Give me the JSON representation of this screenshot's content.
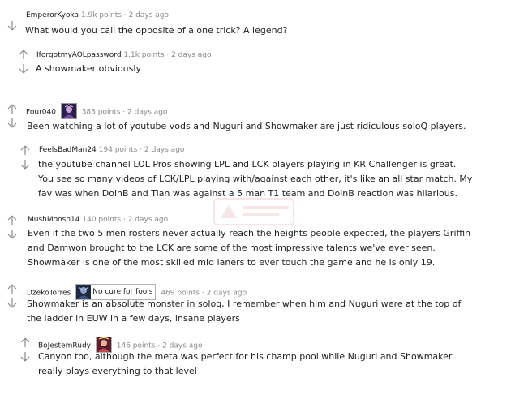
{
  "comments": [
    {
      "author": "EmperorKyoka",
      "points": "1.9k points",
      "separator": "·",
      "time": "2 days ago",
      "lines": [
        "What would you call the opposite of a one trick? A legend?"
      ]
    },
    {
      "author": "IforgotmyAOLpassword",
      "points": "1.1k points",
      "separator": "·",
      "time": "2 days ago",
      "lines": [
        "A showmaker obviously"
      ]
    },
    {
      "author": "Four040",
      "flair_icon": "champion-portrait-purple-icon",
      "points": "383 points",
      "separator": "·",
      "time": "2 days ago",
      "lines": [
        "Been watching a lot of youtube vods and Nuguri and Showmaker are just ridiculous soloQ players."
      ]
    },
    {
      "author": "FeelsBadMan24",
      "points": "194 points",
      "separator": "·",
      "time": "2 days ago",
      "lines": [
        "the youtube channel LOL Pros showing LPL and LCK players playing in KR Challenger is great.",
        "You see so many videos of LCK/LPL playing with/against each other, it's like an all star match. My",
        "fav was when DoinB and Tian was against a 5 man T1 team and DoinB reaction was hilarious."
      ]
    },
    {
      "author": "MushMoosh14",
      "points": "140 points",
      "separator": "·",
      "time": "2 days ago",
      "lines": [
        "Even if the two 5 men rosters never actually reach the heights people expected, the players Griffin",
        "and Damwon brought to the LCK are some of the most impressive talents we've ever seen.",
        "Showmaker is one of the most skilled mid laners to ever touch the game and he is only 19."
      ]
    },
    {
      "author": "DzekoTorres",
      "flair_icon": "champion-portrait-dark-icon",
      "flair_text": "No cure for fools",
      "points": "469 points",
      "separator": "·",
      "time": "2 days ago",
      "lines": [
        "Showmaker is an absolute monster in soloq, I remember when him and Nuguri were at the top of",
        "the ladder in EUW in a few days, insane players"
      ]
    },
    {
      "author": "BoJestemRudy",
      "flair_icon": "champion-portrait-red-icon",
      "points": "146 points",
      "separator": "·",
      "time": "2 days ago",
      "lines": [
        "Canyon too, although the meta was perfect for his champ pool while Nuguri and Showmaker",
        "really plays everything to that level"
      ]
    }
  ],
  "icons": {
    "upvote": "upvote-arrow-icon",
    "downvote": "downvote-arrow-icon",
    "watermark": "site-watermark-logo"
  },
  "colors": {
    "meta_gray": "#878a8c",
    "author": "#1c1c1c",
    "body_text": "#222222",
    "vote_arrow": "#878a8c",
    "background": "#ffffff"
  }
}
